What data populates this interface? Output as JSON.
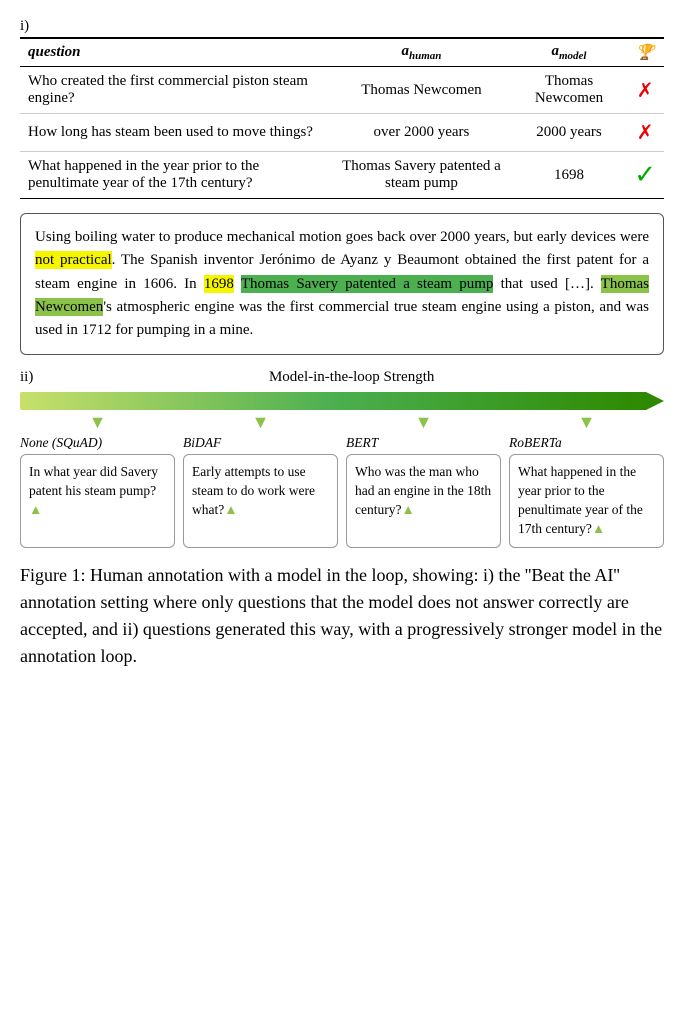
{
  "section_i_label": "i)",
  "table": {
    "headers": {
      "question": "question",
      "a_human": "a",
      "a_human_sub": "human",
      "a_model": "a",
      "a_model_sub": "model",
      "trophy": "🏆"
    },
    "rows": [
      {
        "question": "Who created the first commercial piston steam engine?",
        "a_human": "Thomas Newcomen",
        "a_model": "Thomas Newcomen",
        "correct": false
      },
      {
        "question": "How long has steam been used to move things?",
        "a_human": "over 2000 years",
        "a_model": "2000 years",
        "correct": false
      },
      {
        "question": "What happened in the year prior to the penultimate year of the 17th century?",
        "a_human": "Thomas Savery patented a steam pump",
        "a_model": "1698",
        "correct": true
      }
    ]
  },
  "passage": {
    "text_parts": [
      {
        "text": "Using boiling water to produce mechanical motion goes back over 2000 years, but early devices were ",
        "highlight": "none"
      },
      {
        "text": "not practical",
        "highlight": "yellow"
      },
      {
        "text": ". The Spanish inventor Jerónimo de Ayanz y Beaumont obtained the first patent for a steam engine in 1606. In ",
        "highlight": "none"
      },
      {
        "text": "1698",
        "highlight": "yellow"
      },
      {
        "text": " ",
        "highlight": "none"
      },
      {
        "text": "Thomas Savery patented a steam pump",
        "highlight": "green"
      },
      {
        "text": " that used […]. ",
        "highlight": "none"
      },
      {
        "text": "Thomas Newcomen",
        "highlight": "green-light"
      },
      {
        "text": "'s atmospheric engine was the first commercial true steam engine using a piston, and was used in 1712 for pumping in a mine.",
        "highlight": "none"
      }
    ]
  },
  "section_ii_label": "ii)",
  "mitl_title": "Model-in-the-loop Strength",
  "cards": [
    {
      "model_label": "None (SQuAD)",
      "question_text": "In what year did Savery patent his steam pump?▲"
    },
    {
      "model_label": "BiDAF",
      "question_text": "Early attempts to use steam to do work were what?▲"
    },
    {
      "model_label": "BERT",
      "question_text": "Who was the man who had an engine in the 18th century?▲"
    },
    {
      "model_label": "RoBERTa",
      "question_text": "What happened in the year prior to the penultimate year of the 17th century?▲"
    }
  ],
  "figure_caption": "Figure 1: Human annotation with a model in the loop, showing: i) the ''Beat the AI'' annotation setting where only questions that the model does not answer correctly are accepted, and ii) questions generated this way, with a progressively stronger model in the annotation loop."
}
